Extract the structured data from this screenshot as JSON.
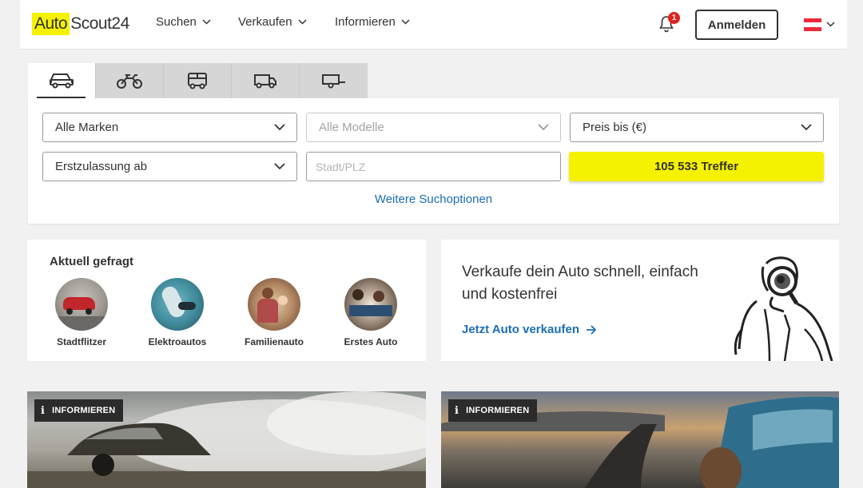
{
  "header": {
    "logo_part1": "Auto",
    "logo_part2": "Scout24",
    "nav": [
      {
        "label": "Suchen"
      },
      {
        "label": "Verkaufen"
      },
      {
        "label": "Informieren"
      }
    ],
    "notification_count": "1",
    "login_label": "Anmelden",
    "flag_colors": [
      "#ed2939",
      "#ffffff",
      "#ed2939"
    ]
  },
  "vehicle_tabs": [
    {
      "icon": "car-icon",
      "active": true
    },
    {
      "icon": "motorcycle-icon",
      "active": false
    },
    {
      "icon": "camper-icon",
      "active": false
    },
    {
      "icon": "van-icon",
      "active": false
    },
    {
      "icon": "trailer-icon",
      "active": false
    }
  ],
  "search": {
    "make": "Alle Marken",
    "model": "Alle Modelle",
    "price": "Preis bis (€)",
    "registration": "Erstzulassung ab",
    "location_placeholder": "Stadt/PLZ",
    "results_label": "105 533 Treffer",
    "more_options": "Weitere Suchoptionen"
  },
  "trending": {
    "title": "Aktuell gefragt",
    "items": [
      {
        "label": "Stadtflitzer"
      },
      {
        "label": "Elektroautos"
      },
      {
        "label": "Familienauto"
      },
      {
        "label": "Erstes Auto"
      }
    ]
  },
  "sell": {
    "headline": "Verkaufe dein Auto schnell, einfach und kostenfrei",
    "link": "Jetzt Auto verkaufen"
  },
  "articles": [
    {
      "badge": "INFORMIEREN"
    },
    {
      "badge": "INFORMIEREN"
    }
  ],
  "colors": {
    "accent_yellow": "#f5f200",
    "link_blue": "#1b6eb4",
    "badge_red": "#e2211c"
  }
}
